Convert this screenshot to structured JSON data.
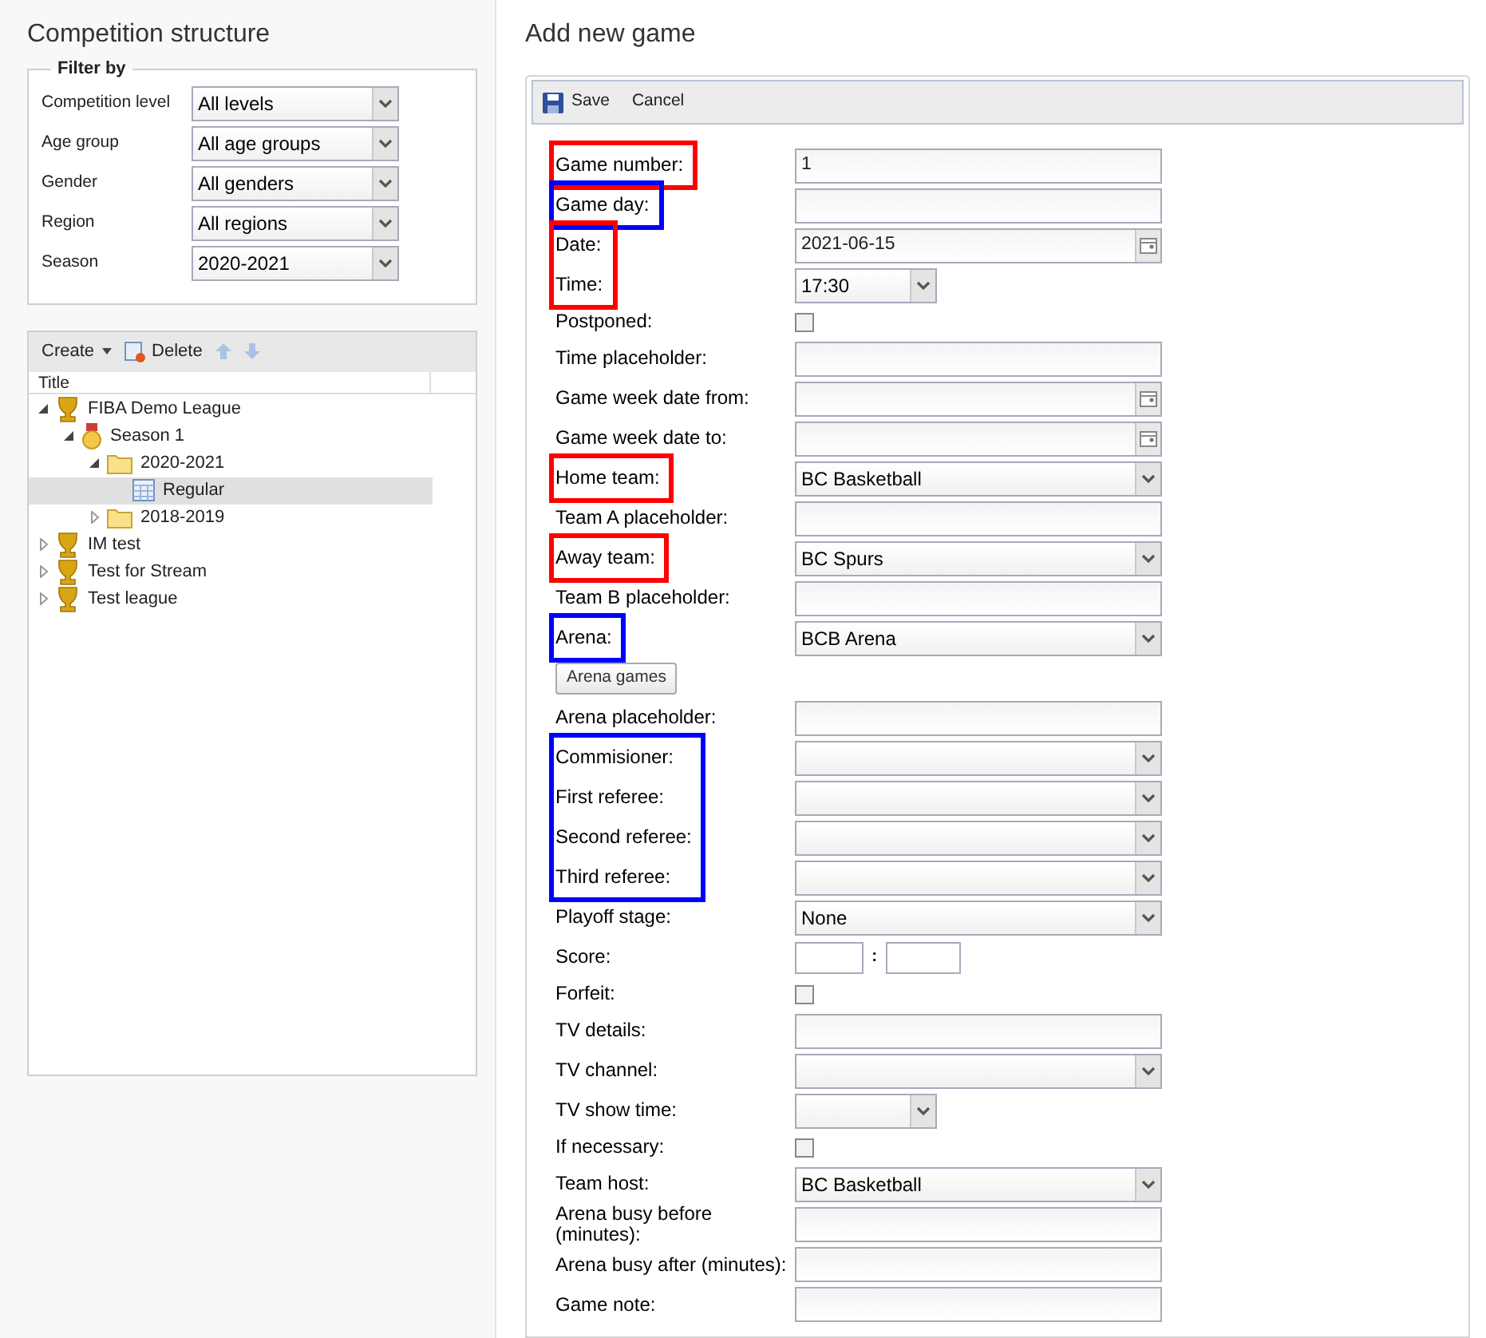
{
  "left": {
    "title": "Competition structure",
    "filter": {
      "legend": "Filter by",
      "fields": [
        {
          "label": "Competition level",
          "value": "All levels"
        },
        {
          "label": "Age group",
          "value": "All age groups"
        },
        {
          "label": "Gender",
          "value": "All genders"
        },
        {
          "label": "Region",
          "value": "All regions"
        },
        {
          "label": "Season",
          "value": "2020-2021"
        }
      ]
    },
    "toolbar": {
      "create": "Create",
      "delete": "Delete"
    },
    "tree": {
      "column": "Title",
      "nodes": [
        {
          "label": "FIBA Demo League",
          "expanded": true,
          "selected": false,
          "children": [
            {
              "label": "Season 1",
              "expanded": true,
              "selected": false,
              "children": [
                {
                  "label": "2020-2021",
                  "expanded": true,
                  "selected": false,
                  "children": [
                    {
                      "label": "Regular",
                      "selected": true
                    }
                  ]
                },
                {
                  "label": "2018-2019",
                  "expanded": false,
                  "selected": false
                }
              ]
            }
          ]
        },
        {
          "label": "IM test",
          "expanded": false,
          "selected": false
        },
        {
          "label": "Test for Stream",
          "expanded": false,
          "selected": false
        },
        {
          "label": "Test league",
          "expanded": false,
          "selected": false
        }
      ]
    }
  },
  "right": {
    "title": "Add new game",
    "toolbar": {
      "save": "Save",
      "cancel": "Cancel"
    },
    "sections": [
      {
        "color": "#ff0000",
        "rows": [
          {
            "kind": "text",
            "label": "Game number:",
            "value": "1"
          }
        ]
      },
      {
        "color": "#0000ff",
        "rows": [
          {
            "kind": "text",
            "label": "Game day:"
          }
        ]
      },
      {
        "color": "#ff0000",
        "rows": [
          {
            "kind": "date",
            "label": "Date:",
            "value": "2021-06-15"
          },
          {
            "kind": "time",
            "label": "Time:",
            "value": "17:30"
          }
        ]
      },
      {
        "rows": [
          {
            "kind": "checkbox",
            "label": "Postponed:",
            "checked": false
          },
          {
            "kind": "text",
            "label": "Time placeholder:"
          },
          {
            "kind": "date",
            "label": "Game week date from:"
          },
          {
            "kind": "date",
            "label": "Game week date to:"
          }
        ]
      },
      {
        "color": "#ff0000",
        "rows": [
          {
            "kind": "select",
            "label": "Home team:",
            "value": "BC Basketball"
          }
        ]
      },
      {
        "rows": [
          {
            "kind": "text",
            "label": "Team A placeholder:"
          }
        ]
      },
      {
        "color": "#ff0000",
        "rows": [
          {
            "kind": "select",
            "label": "Away team:",
            "value": "BC Spurs"
          }
        ]
      },
      {
        "rows": [
          {
            "kind": "text",
            "label": "Team B placeholder:"
          }
        ]
      },
      {
        "color": "#0000ff",
        "rows": [
          {
            "kind": "select",
            "label": "Arena:",
            "value": "BCB Arena"
          }
        ]
      },
      {
        "rows": [
          {
            "kind": "button",
            "label": "Arena games"
          },
          {
            "kind": "text",
            "label": "Arena placeholder:"
          }
        ]
      },
      {
        "color": "#0000ff",
        "rows": [
          {
            "kind": "select",
            "label": "Commisioner:"
          },
          {
            "kind": "select",
            "label": "First referee:"
          },
          {
            "kind": "select",
            "label": "Second referee:"
          },
          {
            "kind": "select",
            "label": "Third referee:"
          }
        ]
      },
      {
        "rows": [
          {
            "kind": "select",
            "label": "Playoff stage:",
            "value": "None"
          },
          {
            "kind": "score",
            "label": "Score:",
            "separator": ":"
          },
          {
            "kind": "checkbox",
            "label": "Forfeit:",
            "checked": false
          },
          {
            "kind": "text",
            "label": "TV details:"
          },
          {
            "kind": "select",
            "label": "TV channel:"
          },
          {
            "kind": "time",
            "label": "TV show time:"
          },
          {
            "kind": "checkbox",
            "label": "If necessary:",
            "checked": false
          },
          {
            "kind": "select",
            "label": "Team host:",
            "value": "BC Basketball"
          },
          {
            "kind": "text",
            "label": "Arena busy before (minutes):"
          },
          {
            "kind": "text",
            "label": "Arena busy after (minutes):"
          },
          {
            "kind": "text",
            "label": "Game note:"
          }
        ]
      }
    ]
  }
}
